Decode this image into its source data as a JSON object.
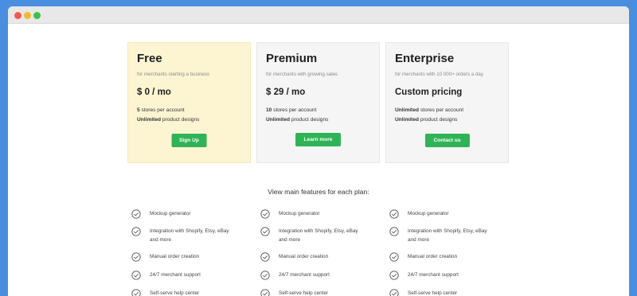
{
  "plans": [
    {
      "name": "Free",
      "subtitle": "for merchants starting a business",
      "price": "$ 0 / mo",
      "line1_bold": "5",
      "line1_rest": " stores per account",
      "line2_bold": "Unlimited",
      "line2_rest": " product designs",
      "button": "Sign Up",
      "bg": "#fdf5d2"
    },
    {
      "name": "Premium",
      "subtitle": "for merchants with growing sales",
      "price": "$ 29 / mo",
      "line1_bold": "10",
      "line1_rest": " stores per account",
      "line2_bold": "Unlimited",
      "line2_rest": " product designs",
      "button": "Learn more",
      "bg": "#f5f5f5"
    },
    {
      "name": "Enterprise",
      "subtitle": "for merchants with 10 000+ orders a day",
      "price": "Custom pricing",
      "line1_bold": "Unlimited",
      "line1_rest": " stores per account",
      "line2_bold": "Unlimited",
      "line2_rest": " product designs",
      "button": "Contact us",
      "bg": "#f5f5f5"
    }
  ],
  "features_heading": "View main features for each plan:",
  "features": [
    "Mockup generator",
    "Integration with Shopify, Etsy, eBay and more",
    "Manual order creation",
    "24/7 merchant support",
    "Self-serve help center"
  ],
  "colors": {
    "accent_button": "#2fb356",
    "page_background": "#4a8ee0"
  }
}
